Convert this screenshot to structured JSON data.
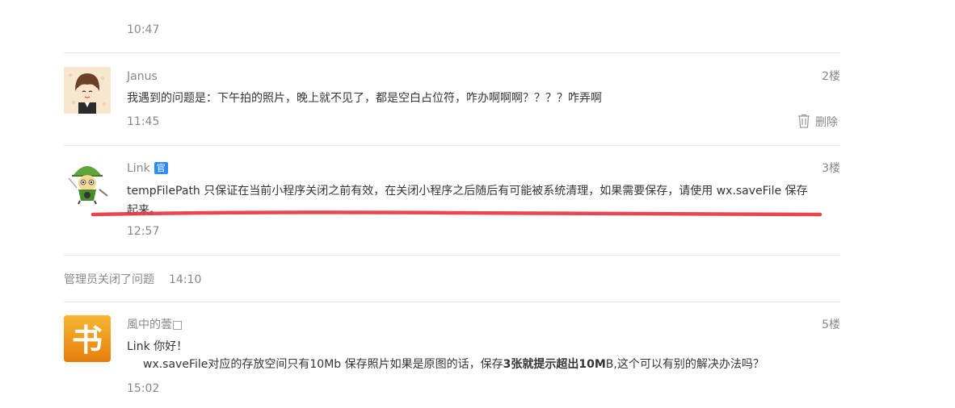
{
  "top_time": "10:47",
  "comments": [
    {
      "name": "Janus",
      "floor": "2楼",
      "content": "我遇到的问题是：下午拍的照片，晚上就不见了，都是空白占位符，咋办啊啊啊？？？？咋弄啊",
      "time": "11:45",
      "delete_label": "删除",
      "avatar_icon": "cartoon-boy-avatar"
    },
    {
      "name": "Link",
      "badge": "官",
      "floor": "3楼",
      "content": "tempFilePath 只保证在当前小程序关闭之前有效，在关闭小程序之后随后有可能被系统清理，如果需要保存，请使用 wx.saveFile 保存起来。",
      "time": "12:57",
      "avatar_icon": "link-character-avatar"
    }
  ],
  "admin_event": {
    "text": "管理员关闭了问题",
    "time": "14:10"
  },
  "last_comment": {
    "name": "風中的蕓□",
    "floor": "5楼",
    "line1": "Link 你好！",
    "line2_pre": "wx.saveFile对应的存放空间只有10Mb 保存照片如果是原图的话，保存",
    "line2_bold": "3张就提示超出10M",
    "line2_post": "B,这个可以有别的解决办法吗？",
    "time": "15:02",
    "avatar_icon": "book-app-avatar",
    "avatar_char": "书"
  },
  "colors": {
    "underline": "#e8323c",
    "badge": "#2d8cf0",
    "book_orange": "#f39c12"
  }
}
